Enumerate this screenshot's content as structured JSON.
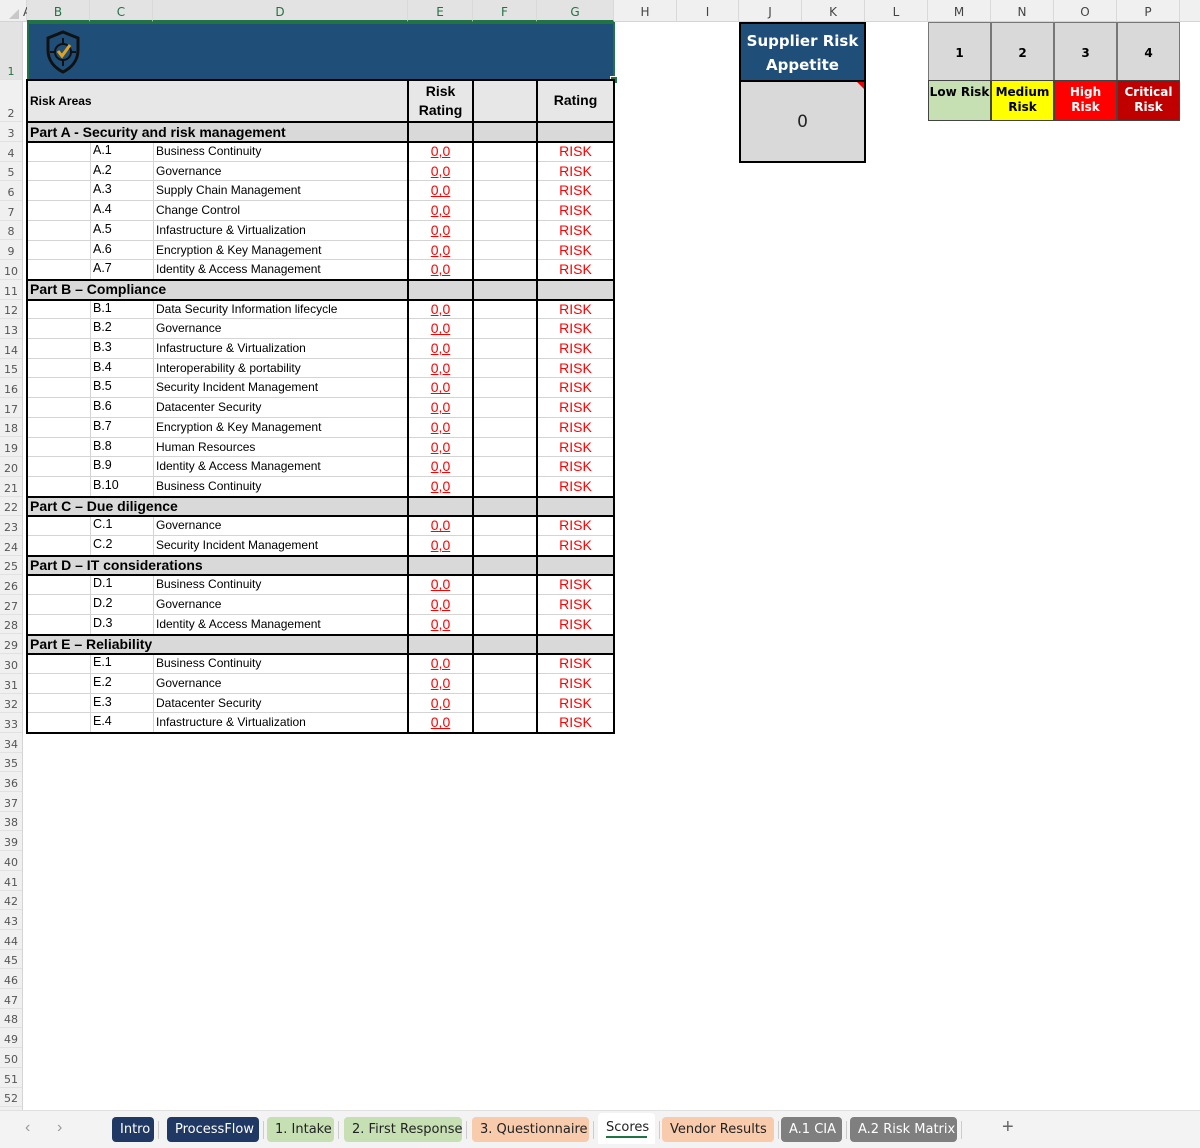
{
  "sheet": {
    "columns": [
      "A",
      "B",
      "C",
      "D",
      "E",
      "F",
      "G",
      "H",
      "I",
      "J",
      "K",
      "L",
      "M",
      "N",
      "O",
      "P"
    ],
    "rows_visible": [
      1,
      2,
      3,
      4,
      5,
      6,
      7,
      8,
      9,
      10,
      11,
      12,
      13,
      14,
      15,
      16,
      17,
      18,
      19,
      20,
      21,
      22,
      23,
      24,
      25,
      26,
      27,
      28,
      29,
      30,
      31,
      32,
      33,
      34,
      35,
      36,
      37,
      38,
      39,
      40,
      41,
      42,
      43,
      44,
      45,
      46,
      47,
      48,
      49,
      50,
      51,
      52
    ]
  },
  "banner": {
    "logo_icon": "shield-check-icon",
    "color": "#1f4e79"
  },
  "table": {
    "header": {
      "risk_areas": "Risk Areas",
      "risk_rating": "Risk Rating",
      "blank": "",
      "rating": "Rating"
    },
    "parts": [
      {
        "title": "Part A - Security and risk management",
        "items": [
          {
            "code": "A.1",
            "name": "Business Continuity",
            "score": "0,0",
            "rating": "RISK"
          },
          {
            "code": "A.2",
            "name": "Governance",
            "score": "0,0",
            "rating": "RISK"
          },
          {
            "code": "A.3",
            "name": "Supply Chain Management",
            "score": "0,0",
            "rating": "RISK"
          },
          {
            "code": "A.4",
            "name": "Change Control",
            "score": "0,0",
            "rating": "RISK"
          },
          {
            "code": "A.5",
            "name": "Infastructure & Virtualization",
            "score": "0,0",
            "rating": "RISK"
          },
          {
            "code": "A.6",
            "name": "Encryption & Key Management",
            "score": "0,0",
            "rating": "RISK"
          },
          {
            "code": "A.7",
            "name": "Identity & Access Management",
            "score": "0,0",
            "rating": "RISK"
          }
        ]
      },
      {
        "title": "Part B – Compliance",
        "merged": true,
        "items": [
          {
            "code": "B.1",
            "name": "Data Security Information lifecycle",
            "score": "0,0",
            "rating": "RISK"
          },
          {
            "code": "B.2",
            "name": "Governance",
            "score": "0,0",
            "rating": "RISK"
          },
          {
            "code": "B.3",
            "name": "Infastructure & Virtualization",
            "score": "0,0",
            "rating": "RISK"
          },
          {
            "code": "B.4",
            "name": "Interoperability & portability",
            "score": "0,0",
            "rating": "RISK"
          },
          {
            "code": "B.5",
            "name": "Security Incident Management",
            "score": "0,0",
            "rating": "RISK"
          },
          {
            "code": "B.6",
            "name": "Datacenter Security",
            "score": "0,0",
            "rating": "RISK"
          },
          {
            "code": "B.7",
            "name": "Encryption & Key Management",
            "score": "0,0",
            "rating": "RISK"
          },
          {
            "code": "B.8",
            "name": "Human Resources",
            "score": "0,0",
            "rating": "RISK"
          },
          {
            "code": "B.9",
            "name": "Identity & Access Management",
            "score": "0,0",
            "rating": "RISK"
          },
          {
            "code": "B.10",
            "name": "Business Continuity",
            "score": "0,0",
            "rating": "RISK"
          }
        ]
      },
      {
        "title": "Part C – Due diligence",
        "items": [
          {
            "code": "C.1",
            "name": "Governance",
            "score": "0,0",
            "rating": "RISK"
          },
          {
            "code": "C.2",
            "name": "Security Incident Management",
            "score": "0,0",
            "rating": "RISK"
          }
        ]
      },
      {
        "title": "Part D – IT considerations",
        "items": [
          {
            "code": "D.1",
            "name": "Business Continuity",
            "score": "0,0",
            "rating": "RISK"
          },
          {
            "code": "D.2",
            "name": "Governance",
            "score": "0,0",
            "rating": "RISK"
          },
          {
            "code": "D.3",
            "name": "Identity & Access Management",
            "score": "0,0",
            "rating": "RISK"
          }
        ]
      },
      {
        "title": "Part E – Reliability",
        "items": [
          {
            "code": "E.1",
            "name": "Business Continuity",
            "score": "0,0",
            "rating": "RISK"
          },
          {
            "code": "E.2",
            "name": "Governance",
            "score": "0,0",
            "rating": "RISK"
          },
          {
            "code": "E.3",
            "name": "Datacenter Security",
            "score": "0,0",
            "rating": "RISK"
          },
          {
            "code": "E.4",
            "name": "Infastructure & Virtualization",
            "score": "0,0",
            "rating": "RISK"
          }
        ]
      }
    ]
  },
  "appetite": {
    "title": "Supplier Risk Appetite",
    "value": "0"
  },
  "legend": [
    {
      "level": "1",
      "label": "Low Risk",
      "bg": "#c6e0b4",
      "fg": "#000000"
    },
    {
      "level": "2",
      "label": "Medium Risk",
      "bg": "#ffff00",
      "fg": "#000000"
    },
    {
      "level": "3",
      "label": "High Risk",
      "bg": "#ff0000",
      "fg": "#ffffff"
    },
    {
      "level": "4",
      "label": "Critical Risk",
      "bg": "#c00000",
      "fg": "#ffffff"
    }
  ],
  "colors": {
    "accent": "#217346",
    "navy": "#1f4e79",
    "risk_red": "#ff0000"
  },
  "tabs": [
    {
      "label": "Intro",
      "bg": "#1f3864",
      "fg": "#ffffff"
    },
    {
      "label": "ProcessFlow",
      "bg": "#1f3864",
      "fg": "#ffffff"
    },
    {
      "label": "1. Intake",
      "bg": "#c6e0b4",
      "fg": "#222222"
    },
    {
      "label": "2. First Response",
      "bg": "#c6e0b4",
      "fg": "#222222"
    },
    {
      "label": "3. Questionnaire",
      "bg": "#f8cbad",
      "fg": "#222222"
    },
    {
      "label": "Scores",
      "active": true
    },
    {
      "label": "Vendor Results",
      "bg": "#f8cbad",
      "fg": "#222222"
    },
    {
      "label": "A.1 CIA",
      "bg": "#7f7f7f",
      "fg": "#ffffff"
    },
    {
      "label": "A.2 Risk Matrix",
      "bg": "#7f7f7f",
      "fg": "#ffffff"
    }
  ],
  "tabbar": {
    "prev_icon": "chevron-left-icon",
    "next_icon": "chevron-right-icon",
    "add_icon": "plus-icon",
    "add_label": "+"
  }
}
